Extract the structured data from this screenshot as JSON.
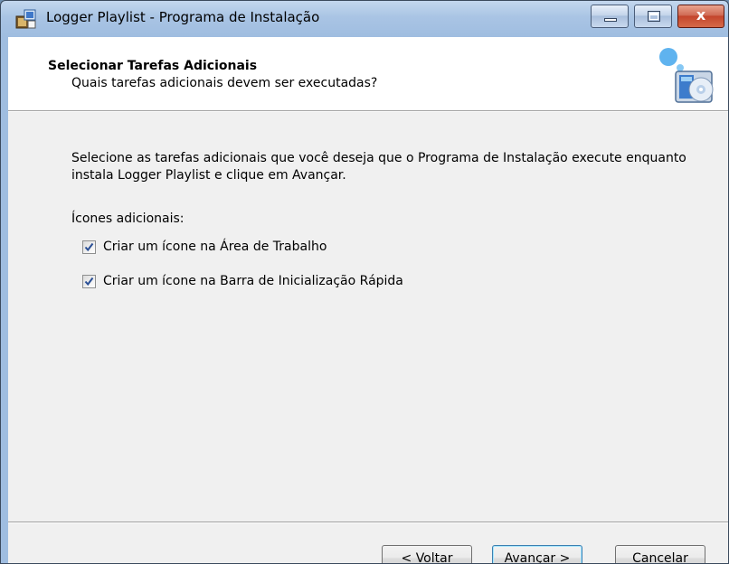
{
  "window": {
    "title": "Logger Playlist - Programa de Instalação",
    "controls": {
      "minimize": "minimize",
      "maximize": "maximize",
      "close": "close"
    },
    "close_glyph": "x"
  },
  "header": {
    "title": "Selecionar Tarefas Adicionais",
    "subtitle": "Quais tarefas adicionais devem ser executadas?",
    "icon": "setup-wizard-icon"
  },
  "body": {
    "description": "Selecione as tarefas adicionais que você deseja que o Programa de Instalação execute enquanto instala Logger Playlist e clique em Avançar.",
    "group_label": "Ícones adicionais:",
    "tasks": [
      {
        "label": "Criar um ícone na Área de Trabalho",
        "checked": true
      },
      {
        "label": "Criar um ícone na Barra de Inicialização Rápida",
        "checked": true
      }
    ]
  },
  "buttons": {
    "back": "< Voltar",
    "next": "Avançar >",
    "cancel": "Cancelar"
  },
  "colors": {
    "titlebar": "#a9c4e4",
    "dialog_bg": "#f0f0f0",
    "header_bg": "#ffffff",
    "check": "#2a4f95",
    "close_button": "#c3452c"
  }
}
